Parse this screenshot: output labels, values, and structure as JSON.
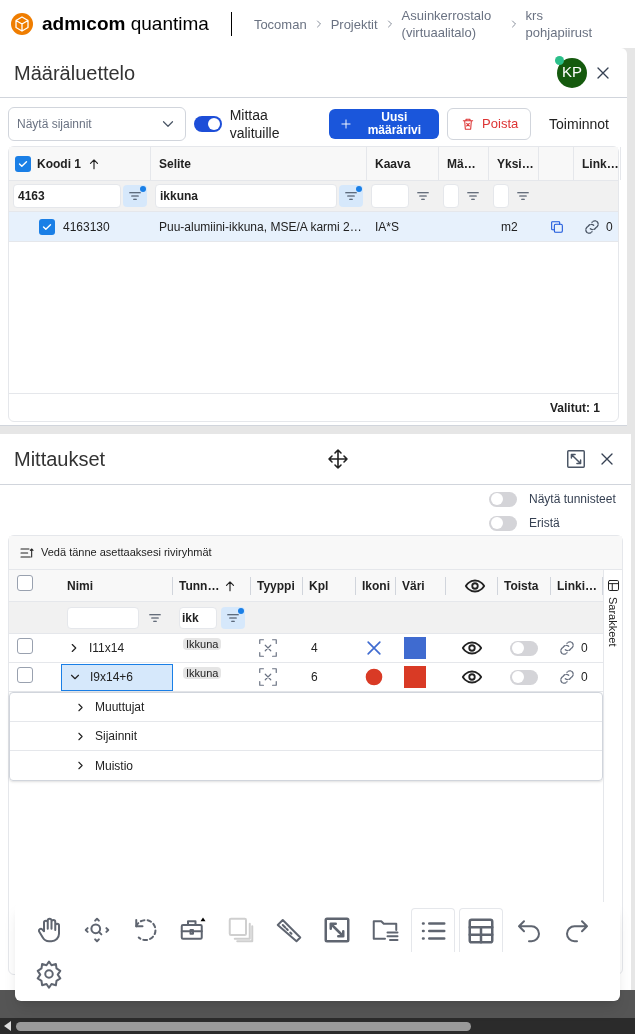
{
  "app_header": {
    "brand": "admıcom",
    "product": "quantima",
    "breadcrumbs": [
      "Tocoman",
      "Projektit",
      "Asuinkerrostalo (virtuaalitalo)",
      "krs pohjapiirust"
    ]
  },
  "quantity_panel": {
    "title": "Määräluettelo",
    "avatar": "KP",
    "online": true,
    "toolbar": {
      "location_select": {
        "placeholder": "Näytä sijainnit"
      },
      "toggle": {
        "label": "Mittaa valituille",
        "on": true
      },
      "new_button": "Uusi määrärivi",
      "delete_button": "Poista",
      "actions_button": "Toiminnot"
    },
    "table": {
      "select_all": true,
      "columns": [
        {
          "label": "Koodi 1",
          "sorted": true
        },
        {
          "label": "Selite"
        },
        {
          "label": "Kaava"
        },
        {
          "label": "Mä…"
        },
        {
          "label": "Yksi…"
        },
        {
          "label": "Link…"
        }
      ],
      "filters": [
        {
          "value": "4163",
          "active": true
        },
        {
          "value": "ikkuna",
          "active": true
        },
        {
          "active": false
        },
        {
          "active": false
        },
        {
          "active": false
        }
      ],
      "rows": [
        {
          "selected": true,
          "code": "4163130",
          "description": "Puu-alumiini-ikkuna, MSE/A karmi 2…",
          "formula": "IA*S",
          "unit": "m2",
          "links": "0"
        }
      ],
      "footer": "Valitut: 1"
    }
  },
  "measurements_panel": {
    "title": "Mittaukset",
    "toggles": [
      {
        "label": "Näytä tunnisteet",
        "on": false
      },
      {
        "label": "Eristä",
        "on": false
      }
    ],
    "group_bar": "Vedä tänne asettaaksesi riviryhmät",
    "table": {
      "select_all": false,
      "columns": [
        {
          "kind": "text",
          "label": "Nimi"
        },
        {
          "kind": "text",
          "label": "Tunn…",
          "sorted": true
        },
        {
          "kind": "text",
          "label": "Tyyppi"
        },
        {
          "kind": "text",
          "label": "Kpl"
        },
        {
          "kind": "text",
          "label": "Ikoni"
        },
        {
          "kind": "text",
          "label": "Väri"
        },
        {
          "kind": "eye"
        },
        {
          "kind": "text",
          "label": "Toista"
        },
        {
          "kind": "text",
          "label": "Linki…"
        }
      ],
      "filters": [
        {
          "active": false
        },
        {
          "value": "ikk",
          "active": true
        }
      ],
      "rows": [
        {
          "checked": false,
          "selected": false,
          "expanded": false,
          "name": "I11x14",
          "tag": "Ikkuna",
          "count": "4",
          "kind": "cross",
          "color": "#3f6bd0",
          "visible": true,
          "repeat": false,
          "links": "0"
        },
        {
          "checked": false,
          "selected": true,
          "expanded": true,
          "name": "I9x14+6",
          "tag": "Ikkuna",
          "count": "6",
          "kind": "circle",
          "color": "#d93a25",
          "visible": true,
          "repeat": false,
          "links": "0"
        }
      ],
      "detail_items": [
        "Muuttujat",
        "Sijainnit",
        "Muistio"
      ],
      "side_tab": "Sarakkeet"
    }
  },
  "bottom_toolbar": [
    {
      "kind": "hand",
      "selected": false,
      "disabled": false
    },
    {
      "kind": "zoom",
      "selected": false,
      "disabled": false
    },
    {
      "kind": "rotate",
      "selected": false,
      "disabled": false
    },
    {
      "kind": "toolbox",
      "selected": false,
      "disabled": false
    },
    {
      "kind": "layers",
      "selected": false,
      "disabled": true
    },
    {
      "kind": "ruler",
      "selected": false,
      "disabled": false
    },
    {
      "kind": "fit",
      "selected": false,
      "disabled": false
    },
    {
      "kind": "folder",
      "selected": false,
      "disabled": false
    },
    {
      "kind": "list",
      "selected": true,
      "disabled": false
    },
    {
      "kind": "table",
      "selected": true,
      "disabled": false
    },
    {
      "kind": "undo",
      "selected": false,
      "disabled": false
    },
    {
      "kind": "redo",
      "selected": false,
      "disabled": false
    },
    {
      "kind": "settings",
      "selected": false,
      "disabled": false
    }
  ]
}
